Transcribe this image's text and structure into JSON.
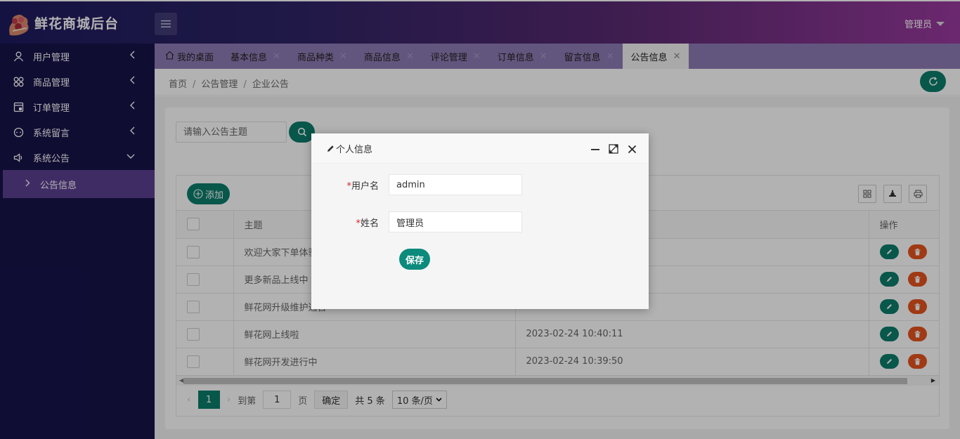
{
  "app": {
    "title": "鲜花商城后台",
    "user_label": "管理员"
  },
  "sidebar": {
    "items": [
      {
        "label": "用户管理"
      },
      {
        "label": "商品管理"
      },
      {
        "label": "订单管理"
      },
      {
        "label": "系统留言"
      },
      {
        "label": "系统公告"
      }
    ],
    "sub_item": {
      "label": "公告信息"
    }
  },
  "tabs": [
    {
      "label": "我的桌面"
    },
    {
      "label": "基本信息"
    },
    {
      "label": "商品种类"
    },
    {
      "label": "商品信息"
    },
    {
      "label": "评论管理"
    },
    {
      "label": "订单信息"
    },
    {
      "label": "留言信息"
    },
    {
      "label": "公告信息"
    }
  ],
  "breadcrumb": [
    "首页",
    "公告管理",
    "企业公告"
  ],
  "search": {
    "placeholder": "请输入公告主题"
  },
  "toolbar": {
    "add_label": "添加"
  },
  "table": {
    "headers": {
      "subject": "主题",
      "time": "",
      "actions": "操作"
    },
    "rows": [
      {
        "subject": "欢迎大家下单体验",
        "time": ""
      },
      {
        "subject": "更多新品上线中",
        "time": ""
      },
      {
        "subject": "鲜花网升级维护通告",
        "time": ""
      },
      {
        "subject": "鲜花网上线啦",
        "time": "2023-02-24 10:40:11"
      },
      {
        "subject": "鲜花网开发进行中",
        "time": "2023-02-24 10:39:50"
      }
    ]
  },
  "pager": {
    "current": "1",
    "goto_label": "到第",
    "goto_value": "1",
    "page_unit": "页",
    "confirm_label": "确定",
    "total_label": "共 5 条",
    "page_size": "10 条/页"
  },
  "modal": {
    "title": "个人信息",
    "username_label": "用户名",
    "username_value": "admin",
    "name_label": "姓名",
    "name_value": "管理员",
    "save_label": "保存"
  },
  "colors": {
    "primary": "#0c7d6c",
    "danger": "#e6541e",
    "sidebar": "#17134a",
    "tabbar": "#8f7bb5"
  }
}
